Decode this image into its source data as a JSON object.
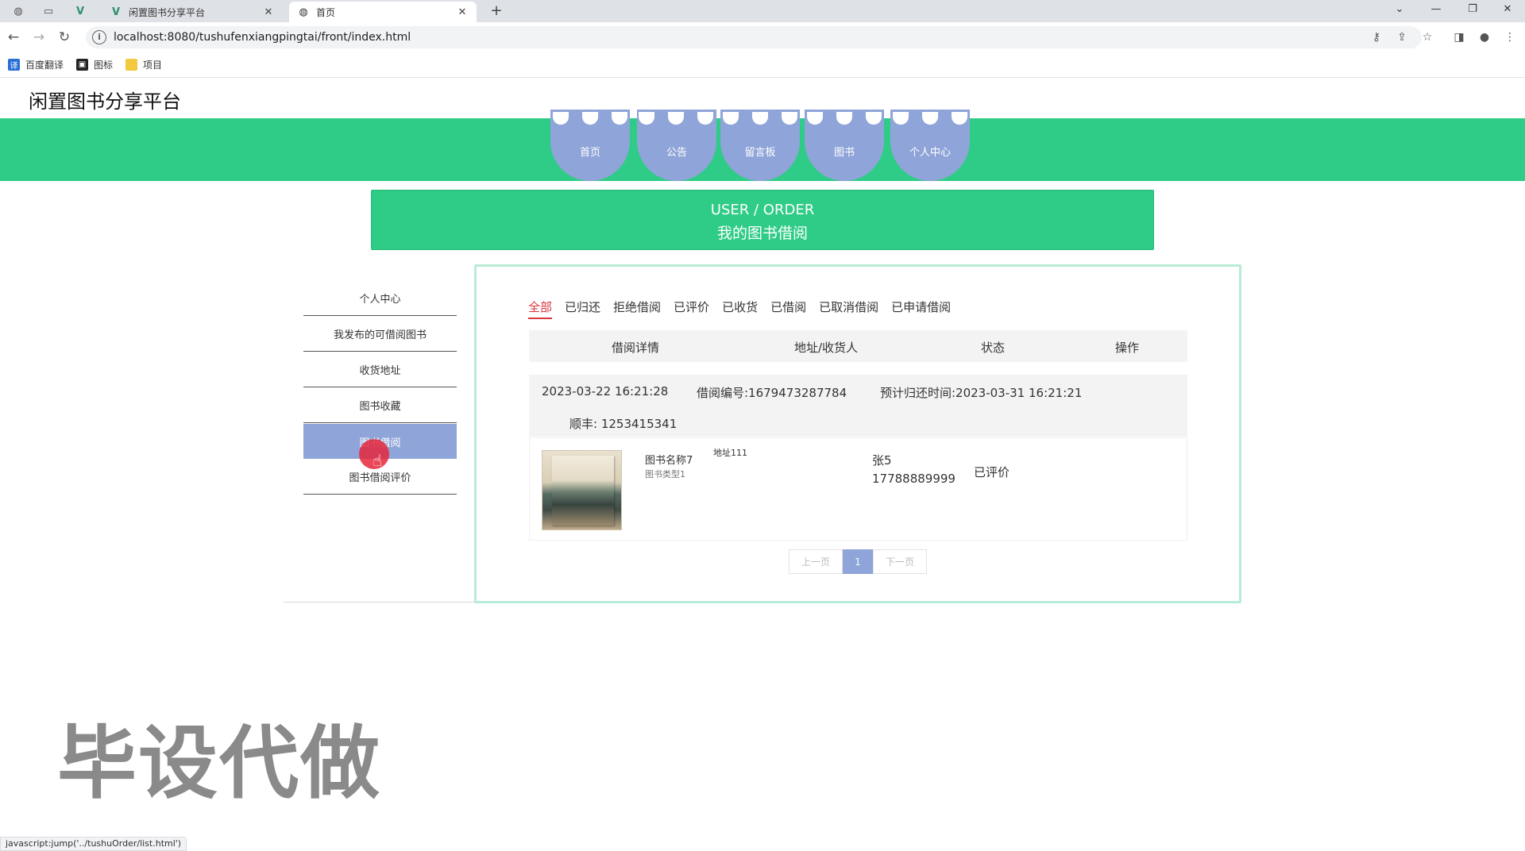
{
  "browser": {
    "tabs": [
      {
        "title": "闲置图书分享平台",
        "icon": "vue-icon",
        "active": false
      },
      {
        "title": "首页",
        "icon": "globe-icon",
        "active": true
      }
    ],
    "url": "localhost:8080/tushufenxiangpingtai/front/index.html",
    "bookmarks": [
      {
        "label": "百度翻译",
        "icon": "translate-icon"
      },
      {
        "label": "图标",
        "icon": "image-icon"
      },
      {
        "label": "项目",
        "icon": "folder-icon"
      }
    ],
    "status_url": "javascript:jump('../tushuOrder/list.html')"
  },
  "site": {
    "title": "闲置图书分享平台"
  },
  "nav": {
    "items": [
      "首页",
      "公告",
      "留言板",
      "图书",
      "个人中心"
    ]
  },
  "banner": {
    "en": "USER / ORDER",
    "cn": "我的图书借阅"
  },
  "sidebar": {
    "items": [
      "个人中心",
      "我发布的可借阅图书",
      "收货地址",
      "图书收藏",
      "图书借阅",
      "图书借阅评价"
    ],
    "active_index": 4
  },
  "filters": {
    "tabs": [
      "全部",
      "已归还",
      "拒绝借阅",
      "已评价",
      "已收货",
      "已借阅",
      "已取消借阅",
      "已申请借阅"
    ],
    "active_index": 0
  },
  "table": {
    "headers": [
      "借阅详情",
      "地址/收货人",
      "状态",
      "操作"
    ]
  },
  "order": {
    "created_at": "2023-03-22 16:21:28",
    "order_no": "借阅编号:1679473287784",
    "due_time": "预计归还时间:2023-03-31 16:21:21",
    "courier": "顺丰:  1253415341",
    "book_name": "图书名称7",
    "book_type": "图书类型1",
    "address": "地址111",
    "receiver_name": "张5",
    "receiver_phone": "17788889999",
    "status": "已评价"
  },
  "pager": {
    "prev": "上一页",
    "current": "1",
    "next": "下一页"
  },
  "watermark": "毕设代做",
  "colors": {
    "accent_green": "#2ecc86",
    "nav_purple": "#8fa4d8",
    "active_red": "#d9363e"
  }
}
